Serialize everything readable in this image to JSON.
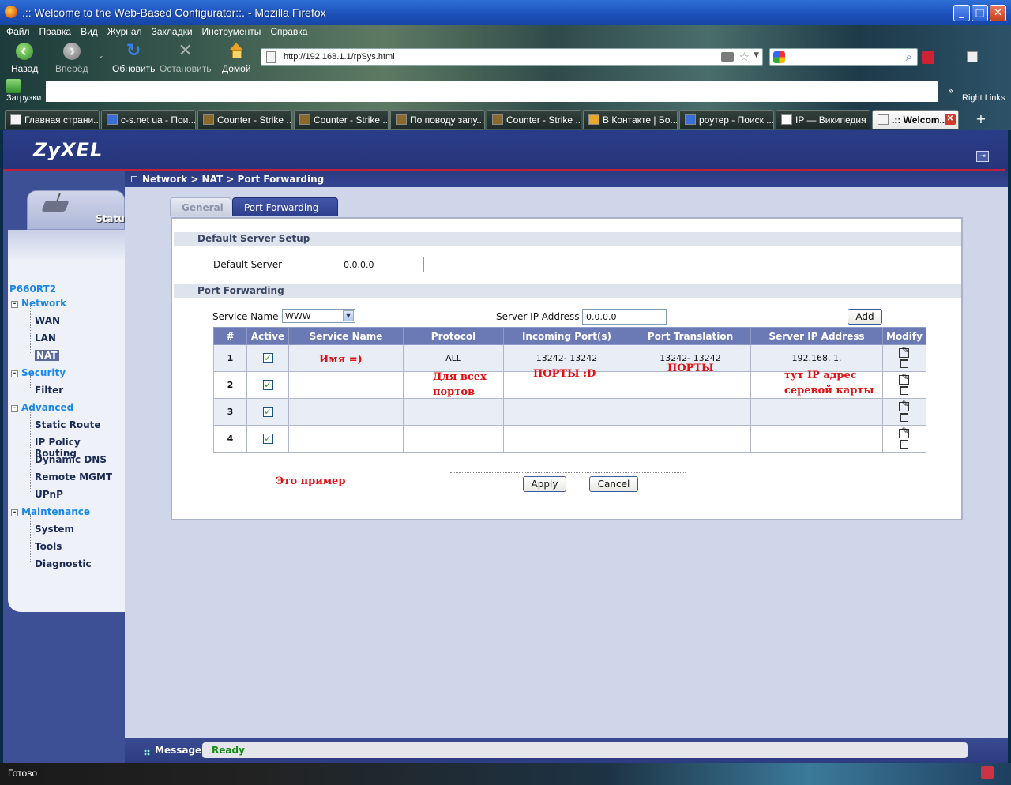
{
  "window": {
    "title": ".:: Welcome to the Web-Based Configurator::. - Mozilla Firefox",
    "minimize": "_",
    "maximize": "□",
    "close": "✕"
  },
  "menu": [
    "Файл",
    "Правка",
    "Вид",
    "Журнал",
    "Закладки",
    "Инструменты",
    "Справка"
  ],
  "toolbar": {
    "back": "Назад",
    "forward": "Вперёд",
    "reload": "Обновить",
    "stop": "Остановить",
    "home": "Домой",
    "downloads": "Загрузки",
    "right_links": "Right Links",
    "bookmarks_chevron": "»"
  },
  "address": {
    "url": "http://192.168.1.1/rpSys.html"
  },
  "tabs": [
    {
      "label": "Главная страни...",
      "icon": "page-icon"
    },
    {
      "label": "c-s.net ua - Пои...",
      "icon": "google-icon"
    },
    {
      "label": "Counter - Strike ...",
      "icon": "cs-icon"
    },
    {
      "label": "Counter - Strike ...",
      "icon": "cs-icon"
    },
    {
      "label": "По поводу запу...",
      "icon": "cs-icon"
    },
    {
      "label": "Counter - Strike ...",
      "icon": "cs-icon"
    },
    {
      "label": "В Контакте | Бо...",
      "icon": "home-icon"
    },
    {
      "label": "роутер - Поиск ...",
      "icon": "google-icon"
    },
    {
      "label": "IP — Википедия",
      "icon": "wikipedia-icon"
    },
    {
      "label": ".:: Welcom...",
      "icon": "page-icon",
      "active": true
    }
  ],
  "zyxel": {
    "logo": "ZyXEL",
    "breadcrumb": "Network > NAT > Port Forwarding",
    "status_tab": "Status",
    "model": "P660RT2",
    "menu": {
      "network": "Network",
      "wan": "WAN",
      "lan": "LAN",
      "nat": "NAT",
      "security": "Security",
      "filter": "Filter",
      "advanced": "Advanced",
      "static_route": "Static Route",
      "ip_policy_routing": "IP Policy Routing",
      "dynamic_dns": "Dynamic DNS",
      "remote_mgmt": "Remote MGMT",
      "upnp": "UPnP",
      "maintenance": "Maintenance",
      "system": "System",
      "tools": "Tools",
      "diagnostic": "Diagnostic",
      "toggle": "-"
    },
    "page_tabs": {
      "general": "General",
      "port_forwarding": "Port Forwarding"
    },
    "default_server_setup": {
      "header": "Default Server Setup",
      "label": "Default Server",
      "value": "0.0.0.0"
    },
    "port_forwarding": {
      "header": "Port Forwarding",
      "service_name_label": "Service Name",
      "service_name_value": "WWW",
      "server_ip_label": "Server IP Address",
      "server_ip_value": "0.0.0.0",
      "add": "Add"
    },
    "table": {
      "columns": [
        "#",
        "Active",
        "Service Name",
        "Protocol",
        "Incoming Port(s)",
        "Port Translation",
        "Server IP Address",
        "Modify"
      ],
      "rows": [
        {
          "num": "1",
          "active": "✓",
          "service": "",
          "protocol": "ALL",
          "incoming": "13242- 13242",
          "translation": "13242- 13242",
          "server_ip": "192.168. 1."
        },
        {
          "num": "2",
          "active": "✓",
          "service": "",
          "protocol": "",
          "incoming": "",
          "translation": "",
          "server_ip": ""
        },
        {
          "num": "3",
          "active": "✓",
          "service": "",
          "protocol": "",
          "incoming": "",
          "translation": "",
          "server_ip": ""
        },
        {
          "num": "4",
          "active": "✓",
          "service": "",
          "protocol": "",
          "incoming": "",
          "translation": "",
          "server_ip": ""
        }
      ]
    },
    "annotations": {
      "name": "Имя =)",
      "all_ports_1": "Для всех",
      "all_ports_2": "портов",
      "ports_d": "ПОРТЫ :D",
      "ports": "ПОРТЫ",
      "ip_note_1": "тут IP адрес",
      "ip_note_2": "серевой карты",
      "example": "Это пример"
    },
    "apply": "Apply",
    "cancel": "Cancel",
    "message_label": "Message",
    "message": "Ready"
  },
  "statusbar": "Готово",
  "colors": {
    "zyxel_blue": "#3d4f95",
    "table_header": "#6b7ab5",
    "link_blue": "#1a88e8",
    "annotation_red": "#e01010",
    "ready_green": "#1b8a1b"
  }
}
